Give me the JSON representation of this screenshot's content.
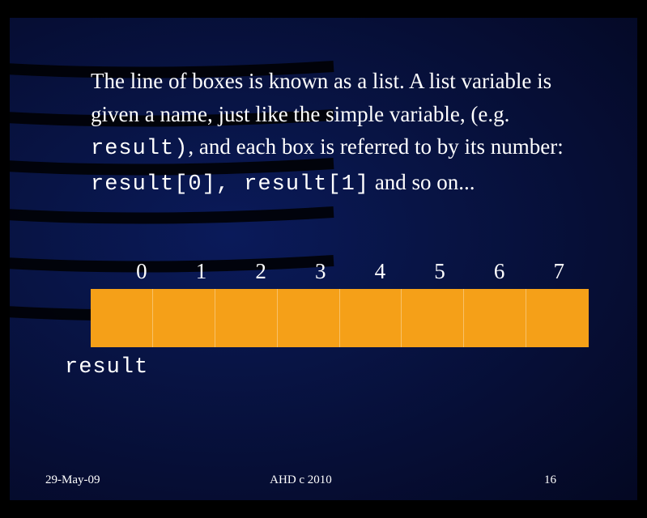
{
  "body": {
    "text_part1": "The line of boxes is known as a list.  A list variable is given a name, just like the simple variable, (e.g. ",
    "code1": "result)",
    "text_part2": ", and each box is referred to by its number:",
    "code2": "result[0], result[1]",
    "text_part3": " and so on..."
  },
  "array": {
    "indices": [
      "0",
      "1",
      "2",
      "3",
      "4",
      "5",
      "6",
      "7"
    ],
    "label": "result"
  },
  "footer": {
    "left": "29-May-09",
    "center": "AHD c 2010",
    "right": "16"
  }
}
